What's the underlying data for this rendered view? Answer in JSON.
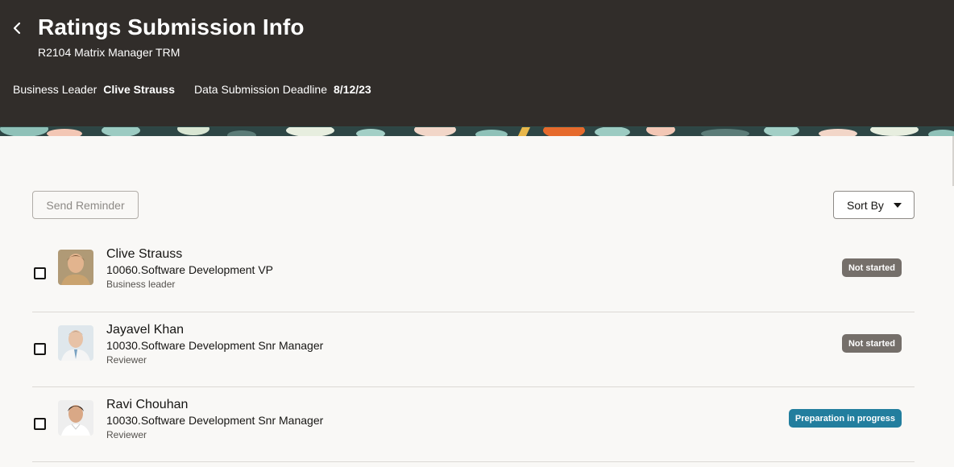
{
  "header": {
    "title": "Ratings Submission Info",
    "subtitle": "R2104 Matrix Manager TRM",
    "business_leader_label": "Business Leader",
    "business_leader_value": "Clive Strauss",
    "deadline_label": "Data Submission Deadline",
    "deadline_value": "8/12/23"
  },
  "toolbar": {
    "send_reminder_label": "Send Reminder",
    "sort_by_label": "Sort By"
  },
  "people": [
    {
      "name": "Clive Strauss",
      "title": "10060.Software Development VP",
      "role": "Business leader",
      "status": "Not started"
    },
    {
      "name": "Jayavel Khan",
      "title": "10030.Software Development Snr Manager",
      "role": "Reviewer",
      "status": "Not started"
    },
    {
      "name": "Ravi Chouhan",
      "title": "10030.Software Development Snr Manager",
      "role": "Reviewer",
      "status": "Preparation in progress"
    }
  ],
  "colors": {
    "header_bg": "#312d2a",
    "status_not_started": "#756f6a",
    "status_in_progress": "#227e9e"
  }
}
